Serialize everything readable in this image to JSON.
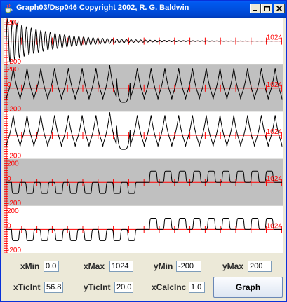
{
  "window": {
    "title": "Graph03/Dsp046 Copyright 2002, R. G. Baldwin",
    "icons": {
      "app": "java-cup-icon",
      "minimize": "minimize-icon",
      "maximize": "maximize-icon",
      "close": "close-icon"
    }
  },
  "colors": {
    "axis": "#FF0000",
    "trace": "#000000",
    "band_light": "#FFFFFF",
    "band_gray": "#C0C0C0",
    "title_bar": "#0054E3",
    "panel_bg": "#ECE9D8"
  },
  "controls": {
    "xmin_label": "xMin",
    "xmin_value": "0.0",
    "xmax_label": "xMax",
    "xmax_value": "1024",
    "ymin_label": "yMin",
    "ymin_value": "-200",
    "ymax_label": "yMax",
    "ymax_value": "200",
    "xticint_label": "xTicInt",
    "xticint_value": "56.8",
    "yticint_label": "yTicInt",
    "yticint_value": "20.0",
    "xcalcinc_label": "xCalcInc",
    "xcalcinc_value": "1.0",
    "graph_label": "Graph"
  },
  "chart_data": [
    {
      "type": "line",
      "name": "decaying-oscillation",
      "background": "light",
      "x_range": [
        0,
        1024
      ],
      "y_range": [
        -200,
        200
      ],
      "x_tick_interval": 56.8,
      "y_tick_interval": 20.0,
      "label_top": "200",
      "label_bottom": "-200",
      "label_right": "1024",
      "shape": "decaying-oscillation"
    },
    {
      "type": "line",
      "name": "cusp-pulse-train",
      "background": "gray",
      "x_range": [
        0,
        1024
      ],
      "y_range": [
        -200,
        200
      ],
      "x_tick_interval": 56.8,
      "y_tick_interval": 20.0,
      "label_top": "200",
      "label_bottom": "-200",
      "label_right": "1024",
      "label_left_axis": "0",
      "shape": "cusp-pulses"
    },
    {
      "type": "line",
      "name": "cusp-pulse-train-2",
      "background": "light",
      "x_range": [
        0,
        1024
      ],
      "y_range": [
        -200,
        200
      ],
      "x_tick_interval": 56.8,
      "y_tick_interval": 20.0,
      "label_top": "",
      "label_bottom": "-200",
      "label_right": "1024",
      "shape": "cusp-pulses"
    },
    {
      "type": "line",
      "name": "square-burst",
      "background": "gray",
      "x_range": [
        0,
        1024
      ],
      "y_range": [
        -200,
        200
      ],
      "x_tick_interval": 56.8,
      "y_tick_interval": 20.0,
      "label_top": "200",
      "label_bottom": "-200",
      "label_right": "1024",
      "label_left_axis": "0",
      "shape": "square-burst"
    },
    {
      "type": "line",
      "name": "square-burst-2",
      "background": "light",
      "x_range": [
        0,
        1024
      ],
      "y_range": [
        -200,
        200
      ],
      "x_tick_interval": 56.8,
      "y_tick_interval": 20.0,
      "label_top": "200",
      "label_bottom": "-200",
      "label_right": "1024",
      "label_left_axis": "0",
      "shape": "square-burst"
    }
  ]
}
